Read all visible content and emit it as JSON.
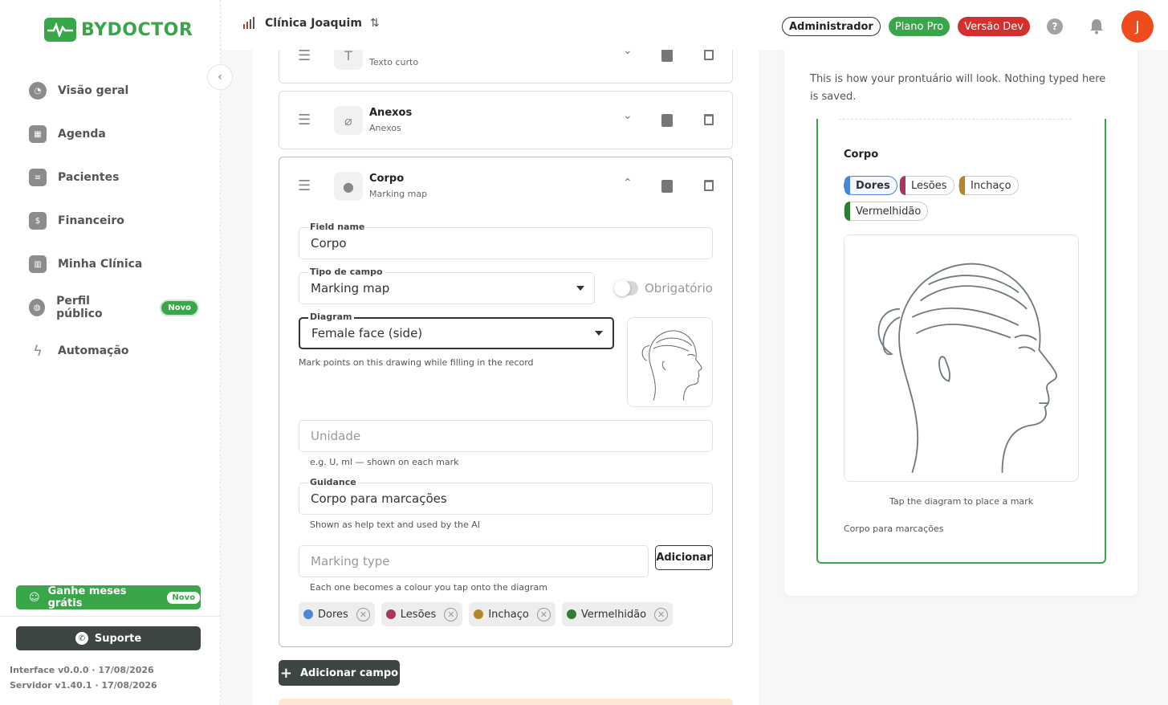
{
  "app": {
    "logo_text": "BYDOCTOR"
  },
  "sidebar": {
    "items": [
      {
        "label": "Visão geral",
        "icon": "pie-chart-icon"
      },
      {
        "label": "Agenda",
        "icon": "calendar-icon"
      },
      {
        "label": "Pacientes",
        "icon": "id-card-icon"
      },
      {
        "label": "Financeiro",
        "icon": "money-bag-icon"
      },
      {
        "label": "Minha Clínica",
        "icon": "building-icon"
      },
      {
        "label": "Perfil público",
        "icon": "globe-icon",
        "badge": "Novo"
      },
      {
        "label": "Automação",
        "icon": "lightning-icon"
      }
    ],
    "promo": {
      "label": "Ganhe meses grátis",
      "badge": "Novo"
    },
    "support": {
      "label": "Suporte"
    },
    "interface_version": "Interface v0.0.0 · 17/08/2026",
    "server_version": "Servidor v1.40.1 · 17/08/2026"
  },
  "header": {
    "clinic_name": "Clínica Joaquim",
    "badges": {
      "admin": "Administrador",
      "pro": "Plano Pro",
      "dev": "Versão Dev"
    },
    "help": "?",
    "avatar_initial": "J"
  },
  "fields": {
    "short_text": {
      "subtitle": "Texto curto"
    },
    "anexos": {
      "title": "Anexos",
      "subtitle": "Anexos"
    },
    "corpo": {
      "title": "Corpo",
      "subtitle": "Marking map"
    }
  },
  "editor": {
    "field_name_label": "Field name",
    "field_name_value": "Corpo",
    "type_label": "Tipo de campo",
    "type_value": "Marking map",
    "required_label": "Obrigatório",
    "diagram_label": "Diagram",
    "diagram_value": "Female face (side)",
    "diagram_helper": "Mark points on this drawing while filling in the record",
    "unit_placeholder": "Unidade",
    "unit_helper": "e.g. U, ml — shown on each mark",
    "guidance_label": "Guidance",
    "guidance_value": "Corpo para marcações",
    "guidance_helper": "Shown as help text and used by the AI",
    "marking_placeholder": "Marking type",
    "add_label": "Adicionar",
    "marking_helper": "Each one becomes a colour you tap onto the diagram",
    "markings": [
      {
        "label": "Dores",
        "color": "#4a86d8"
      },
      {
        "label": "Lesões",
        "color": "#a8385a"
      },
      {
        "label": "Inchaço",
        "color": "#b8862a"
      },
      {
        "label": "Vermelhidão",
        "color": "#2e7d32"
      }
    ]
  },
  "add_field_label": "Adicionar campo",
  "preview": {
    "description": "This is how your prontuário will look. Nothing typed here is saved.",
    "title": "Corpo",
    "hint": "Tap the diagram to place a mark",
    "guidance": "Corpo para marcações"
  },
  "colors": {
    "brand_green": "#3aa64a",
    "dark_button": "#3d4645",
    "danger": "#d32f2f",
    "avatar": "#ee4b1f"
  }
}
